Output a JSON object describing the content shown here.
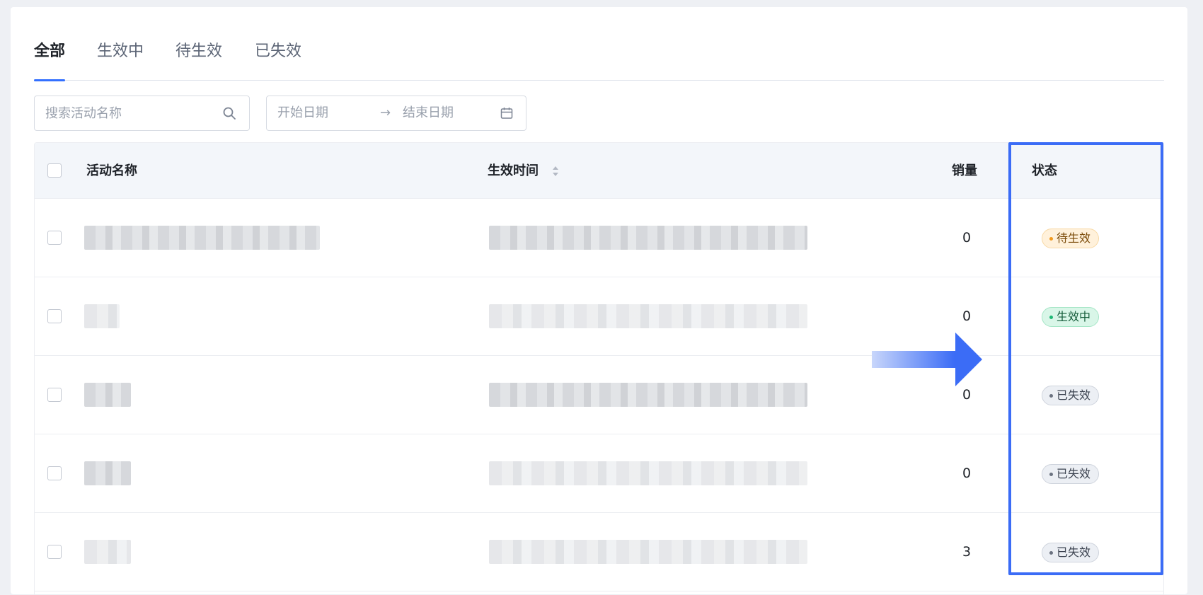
{
  "tabs": [
    {
      "label": "全部",
      "active": true
    },
    {
      "label": "生效中",
      "active": false
    },
    {
      "label": "待生效",
      "active": false
    },
    {
      "label": "已失效",
      "active": false
    }
  ],
  "filters": {
    "search_placeholder": "搜索活动名称",
    "start_date_placeholder": "开始日期",
    "end_date_placeholder": "结束日期",
    "range_separator": "→"
  },
  "table": {
    "columns": {
      "name": "活动名称",
      "time": "生效时间",
      "sales": "销量",
      "status": "状态"
    },
    "rows": [
      {
        "sales": "0",
        "status": "待生效",
        "status_type": "pending"
      },
      {
        "sales": "0",
        "status": "生效中",
        "status_type": "active"
      },
      {
        "sales": "0",
        "status": "已失效",
        "status_type": "expired"
      },
      {
        "sales": "0",
        "status": "已失效",
        "status_type": "expired"
      },
      {
        "sales": "3",
        "status": "已失效",
        "status_type": "expired"
      }
    ]
  },
  "colors": {
    "accent": "#3370ff",
    "highlight_border": "#3b6cf6",
    "pending": "#f29a1f",
    "active": "#1fb875",
    "expired": "#6b7280"
  }
}
